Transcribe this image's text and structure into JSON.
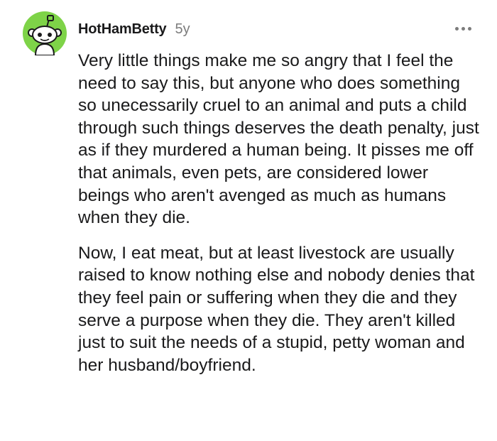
{
  "comment": {
    "username": "HotHamBetty",
    "age": "5y",
    "more_icon": "more-horizontal-icon",
    "avatar_icon": "reddit-snoo-avatar",
    "avatar_color": "#7ed348",
    "paragraphs": [
      "Very little things make me so angry that I feel the need to say this, but anyone who does something so unecessarily cruel to an animal and puts a child through such things deserves the death penalty, just as if they murdered a human being. It pisses me off that animals, even pets, are considered lower beings who aren't avenged as much as humans when they die.",
      "Now, I eat meat, but at least livestock are usually raised to know nothing else and nobody denies that they feel pain or suffering when they die and they serve a purpose when they die. They aren't killed just to suit the needs of a stupid, petty woman and her husband/boyfriend."
    ]
  }
}
